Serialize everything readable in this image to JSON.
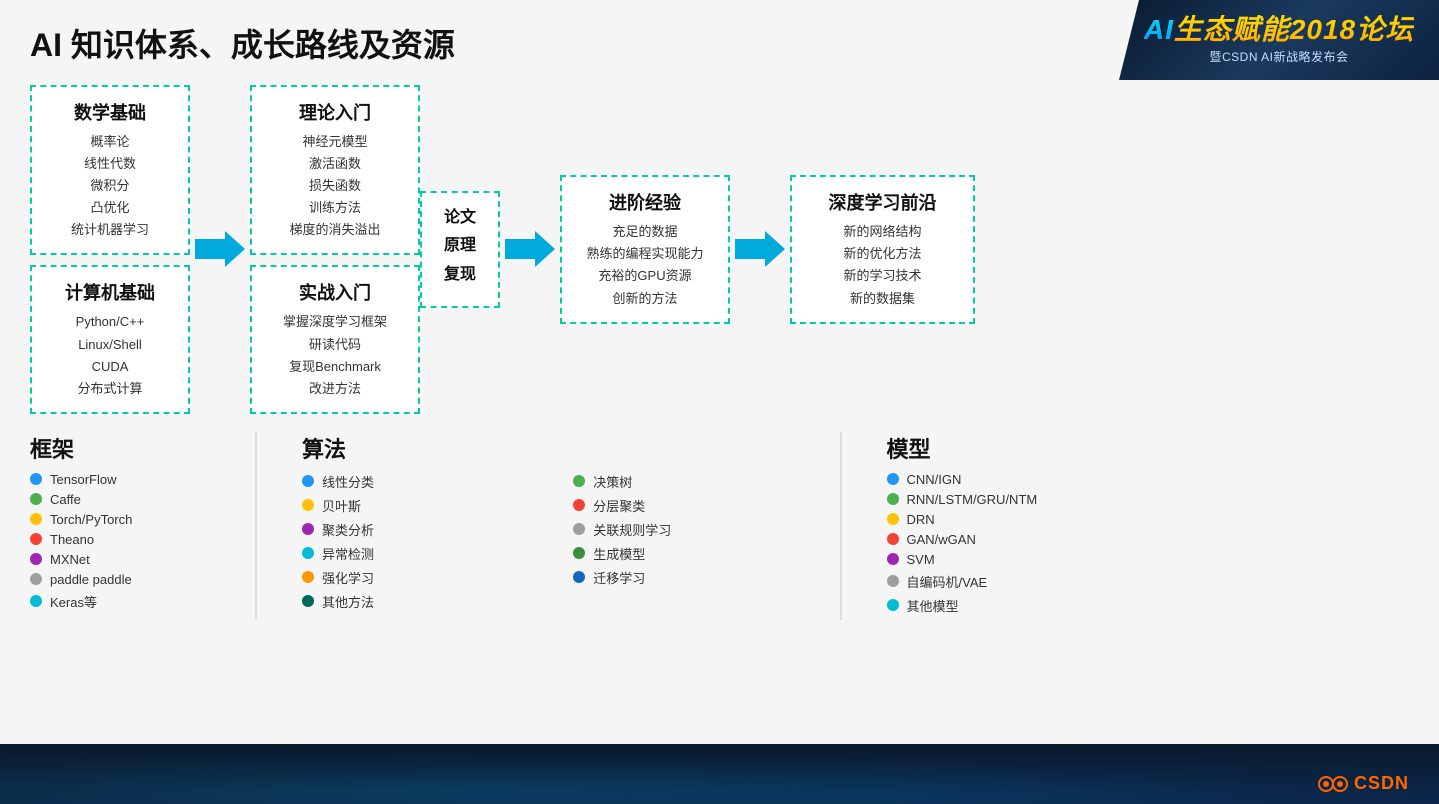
{
  "page": {
    "title": "AI 知识体系、成长路线及资源",
    "bg_color": "#f5f5f5"
  },
  "logo": {
    "title_ai": "AI",
    "title_main": "生态赋能2018论坛",
    "subtitle": "暨CSDN AI新战略发布会"
  },
  "flow": {
    "math_box": {
      "title": "数学基础",
      "items": [
        "概率论",
        "线性代数",
        "微积分",
        "凸优化",
        "统计机器学习"
      ]
    },
    "computer_box": {
      "title": "计算机基础",
      "items": [
        "Python/C++",
        "Linux/Shell",
        "CUDA",
        "分布式计算"
      ]
    },
    "theory_box": {
      "title": "理论入门",
      "items": [
        "神经元模型",
        "激活函数",
        "损失函数",
        "训练方法",
        "梯度的消失溢出"
      ]
    },
    "practice_box": {
      "title": "实战入门",
      "items": [
        "掌握深度学习框架",
        "研读代码",
        "复现Benchmark",
        "改进方法"
      ]
    },
    "paper_box": {
      "lines": [
        "论文",
        "原理",
        "复现"
      ]
    },
    "advanced_box": {
      "title": "进阶经验",
      "items": [
        "充足的数据",
        "熟练的编程实现能力",
        "充裕的GPU资源",
        "创新的方法"
      ]
    },
    "deep_box": {
      "title": "深度学习前沿",
      "items": [
        "新的网络结构",
        "新的优化方法",
        "新的学习技术",
        "新的数据集"
      ]
    }
  },
  "framework": {
    "col_title": "框架",
    "items": [
      {
        "name": "TensorFlow",
        "color": "#2196F3"
      },
      {
        "name": "Caffe",
        "color": "#4CAF50"
      },
      {
        "name": "Torch/PyTorch",
        "color": "#FFC107"
      },
      {
        "name": "Theano",
        "color": "#f44336"
      },
      {
        "name": "MXNet",
        "color": "#9C27B0"
      },
      {
        "name": "paddle paddle",
        "color": "#9E9E9E"
      },
      {
        "name": "Keras等",
        "color": "#00BCD4"
      }
    ]
  },
  "algorithm": {
    "col_title": "算法",
    "items": [
      {
        "name": "线性分类",
        "color": "#2196F3"
      },
      {
        "name": "决策树",
        "color": "#4CAF50"
      },
      {
        "name": "贝叶斯",
        "color": "#FFC107"
      },
      {
        "name": "分层聚类",
        "color": "#f44336"
      },
      {
        "name": "聚类分析",
        "color": "#9C27B0"
      },
      {
        "name": "关联规则学习",
        "color": "#9E9E9E"
      },
      {
        "name": "异常检测",
        "color": "#00BCD4"
      },
      {
        "name": "生成模型",
        "color": "#388E3C"
      },
      {
        "name": "强化学习",
        "color": "#FF9800"
      },
      {
        "name": "迁移学习",
        "color": "#1565C0"
      },
      {
        "name": "其他方法",
        "color": "#00695C"
      }
    ]
  },
  "model": {
    "col_title": "模型",
    "items": [
      {
        "name": "CNN/IGN",
        "color": "#2196F3"
      },
      {
        "name": "RNN/LSTM/GRU/NTM",
        "color": "#4CAF50"
      },
      {
        "name": "DRN",
        "color": "#FFC107"
      },
      {
        "name": "GAN/wGAN",
        "color": "#f44336"
      },
      {
        "name": "SVM",
        "color": "#9C27B0"
      },
      {
        "name": "自编码机/VAE",
        "color": "#9E9E9E"
      },
      {
        "name": "其他模型",
        "color": "#00BCD4"
      }
    ]
  }
}
